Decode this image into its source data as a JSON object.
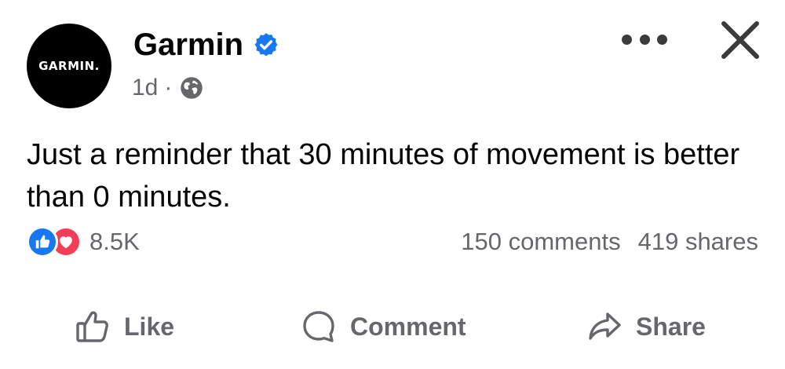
{
  "post": {
    "author": "Garmin",
    "avatar_text": "GARMIN.",
    "verified_icon": "verified-badge-icon",
    "time": "1d",
    "separator": "·",
    "audience_icon": "globe-icon",
    "text": "Just a reminder that 30 minutes of movement is better than 0 minutes."
  },
  "stats": {
    "reaction_icons": [
      "like-reaction-icon",
      "love-reaction-icon"
    ],
    "reaction_count": "8.5K",
    "comments": "150 comments",
    "shares": "419 shares"
  },
  "actions": {
    "like": "Like",
    "comment": "Comment",
    "share": "Share"
  },
  "colors": {
    "brand_blue": "#1877f2",
    "love_red": "#f33e58",
    "secondary_text": "#65676b",
    "avatar_bg": "#000000"
  }
}
